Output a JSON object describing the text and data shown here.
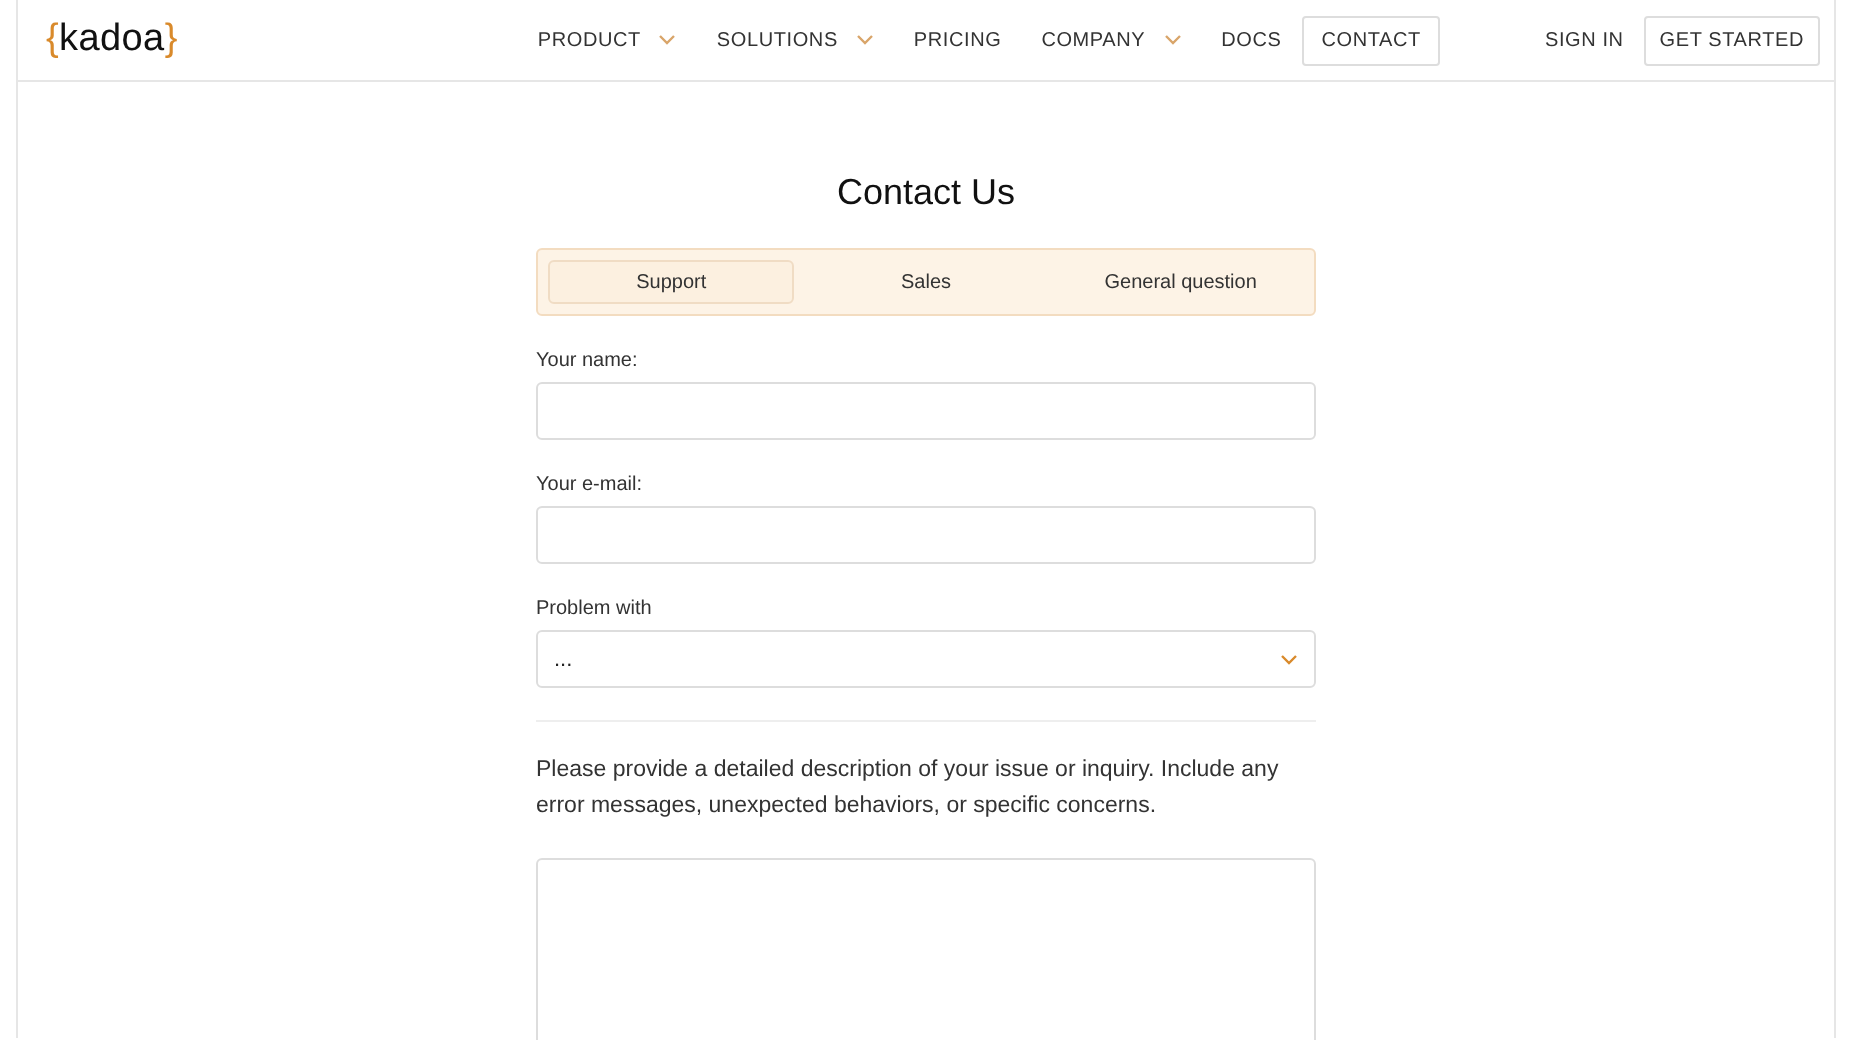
{
  "header": {
    "logo": {
      "open": "{",
      "name": "kadoa",
      "close": "}"
    },
    "nav": [
      {
        "label": "PRODUCT",
        "has_menu": true,
        "selected": false
      },
      {
        "label": "SOLUTIONS",
        "has_menu": true,
        "selected": false
      },
      {
        "label": "PRICING",
        "has_menu": false,
        "selected": false
      },
      {
        "label": "COMPANY",
        "has_menu": true,
        "selected": false
      },
      {
        "label": "DOCS",
        "has_menu": false,
        "selected": false
      },
      {
        "label": "CONTACT",
        "has_menu": false,
        "selected": true
      }
    ],
    "actions": [
      {
        "label": "SIGN IN",
        "kind": "link"
      },
      {
        "label": "GET STARTED",
        "kind": "outlined"
      }
    ]
  },
  "form": {
    "title": "Contact Us",
    "tabs": [
      {
        "label": "Support",
        "selected": true
      },
      {
        "label": "Sales",
        "selected": false
      },
      {
        "label": "General question",
        "selected": false
      }
    ],
    "fields": [
      {
        "kind": "text",
        "label": "Your name:"
      },
      {
        "kind": "text",
        "label": "Your e-mail:"
      },
      {
        "kind": "select",
        "label": "Problem with",
        "value": "..."
      }
    ],
    "description": "Please provide a detailed description of your issue or inquiry. Include any error messages, unexpected behaviors, or specific concerns."
  }
}
